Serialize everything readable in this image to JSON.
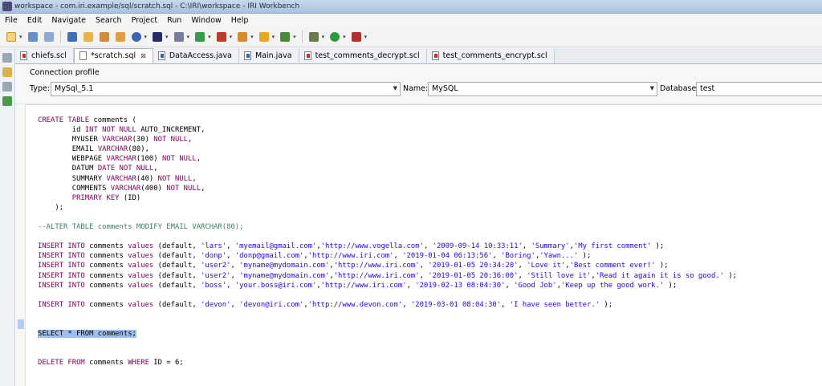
{
  "window": {
    "title": "workspace - com.iri.example/sql/scratch.sql - C:\\IRI\\workspace - IRI Workbench"
  },
  "menu": [
    "File",
    "Edit",
    "Navigate",
    "Search",
    "Project",
    "Run",
    "Window",
    "Help"
  ],
  "tabs": [
    {
      "label": "chiefs.scl",
      "icon": "sql-file-icon",
      "active": false
    },
    {
      "label": "*scratch.sql",
      "icon": "sql-file-icon",
      "active": true,
      "close": "⊠"
    },
    {
      "label": "DataAccess.java",
      "icon": "java-file-icon",
      "active": false
    },
    {
      "label": "Main.java",
      "icon": "java-file-icon",
      "active": false
    },
    {
      "label": "test_comments_decrypt.scl",
      "icon": "sql-file-icon",
      "active": false
    },
    {
      "label": "test_comments_encrypt.scl",
      "icon": "sql-file-icon",
      "active": false
    }
  ],
  "connection": {
    "section_label": "Connection profile",
    "type_label": "Type:",
    "type_value": "MySql_5.1",
    "name_label": "Name:",
    "name_value": "MySQL",
    "database_label": "Database:",
    "database_value": "test"
  },
  "code_lines": [
    [
      [
        "kw",
        "CREATE TABLE"
      ],
      [
        "",
        " comments ("
      ]
    ],
    [
      [
        "",
        "        id "
      ],
      [
        "kw",
        "INT NOT NULL"
      ],
      [
        "",
        " AUTO_INCREMENT,"
      ]
    ],
    [
      [
        "",
        "        MYUSER "
      ],
      [
        "kw",
        "VARCHAR"
      ],
      [
        "",
        "(30) "
      ],
      [
        "kw",
        "NOT NULL"
      ],
      [
        "",
        ","
      ]
    ],
    [
      [
        "",
        "        EMAIL "
      ],
      [
        "kw",
        "VARCHAR"
      ],
      [
        "",
        "(80),"
      ]
    ],
    [
      [
        "",
        "        WEBPAGE "
      ],
      [
        "kw",
        "VARCHAR"
      ],
      [
        "",
        "(100) "
      ],
      [
        "kw",
        "NOT NULL"
      ],
      [
        "",
        ","
      ]
    ],
    [
      [
        "",
        "        DATUM "
      ],
      [
        "kw",
        "DATE NOT NULL"
      ],
      [
        "",
        ","
      ]
    ],
    [
      [
        "",
        "        SUMMARY "
      ],
      [
        "kw",
        "VARCHAR"
      ],
      [
        "",
        "(40) "
      ],
      [
        "kw",
        "NOT NULL"
      ],
      [
        "",
        ","
      ]
    ],
    [
      [
        "",
        "        COMMENTS "
      ],
      [
        "kw",
        "VARCHAR"
      ],
      [
        "",
        "(400) "
      ],
      [
        "kw",
        "NOT NULL"
      ],
      [
        "",
        ","
      ]
    ],
    [
      [
        "",
        "        "
      ],
      [
        "kw",
        "PRIMARY KEY"
      ],
      [
        "",
        " (ID)"
      ]
    ],
    [
      [
        "",
        "    );"
      ]
    ],
    [
      [
        "",
        ""
      ]
    ],
    [
      [
        "cm",
        "--ALTER TABLE comments MODIFY EMAIL VARCHAR(80);"
      ]
    ],
    [
      [
        "",
        ""
      ]
    ],
    [
      [
        "kw",
        "INSERT INTO"
      ],
      [
        "",
        " comments "
      ],
      [
        "kw",
        "values"
      ],
      [
        "",
        " (default, "
      ],
      [
        "str",
        "'lars'"
      ],
      [
        "",
        ", "
      ],
      [
        "str",
        "'myemail@gmail.com'"
      ],
      [
        "",
        ","
      ],
      [
        "str",
        "'http://www.vogella.com'"
      ],
      [
        "",
        ", "
      ],
      [
        "str",
        "'2009-09-14 10:33:11'"
      ],
      [
        "",
        ", "
      ],
      [
        "str",
        "'Summary'"
      ],
      [
        "",
        ","
      ],
      [
        "str",
        "'My first comment'"
      ],
      [
        "",
        " );"
      ]
    ],
    [
      [
        "kw",
        "INSERT INTO"
      ],
      [
        "",
        " comments "
      ],
      [
        "kw",
        "values"
      ],
      [
        "",
        " (default, "
      ],
      [
        "str",
        "'donp'"
      ],
      [
        "",
        ", "
      ],
      [
        "str",
        "'donp@gmail.com'"
      ],
      [
        "",
        ","
      ],
      [
        "str",
        "'http://www.iri.com'"
      ],
      [
        "",
        ", "
      ],
      [
        "str",
        "'2019-01-04 06:13:56'"
      ],
      [
        "",
        ", "
      ],
      [
        "str",
        "'Boring'"
      ],
      [
        "",
        ","
      ],
      [
        "str",
        "'Yawn...'"
      ],
      [
        "",
        " );"
      ]
    ],
    [
      [
        "kw",
        "INSERT INTO"
      ],
      [
        "",
        " comments "
      ],
      [
        "kw",
        "values"
      ],
      [
        "",
        " (default, "
      ],
      [
        "str",
        "'user2'"
      ],
      [
        "",
        ", "
      ],
      [
        "str",
        "'myname@mydomain.com'"
      ],
      [
        "",
        ","
      ],
      [
        "str",
        "'http://www.iri.com'"
      ],
      [
        "",
        ", "
      ],
      [
        "str",
        "'2019-01-05 20:34:20'"
      ],
      [
        "",
        ", "
      ],
      [
        "str",
        "'Love it'"
      ],
      [
        "",
        ","
      ],
      [
        "str",
        "'Best comment ever!'"
      ],
      [
        "",
        " );"
      ]
    ],
    [
      [
        "kw",
        "INSERT INTO"
      ],
      [
        "",
        " comments "
      ],
      [
        "kw",
        "values"
      ],
      [
        "",
        " (default, "
      ],
      [
        "str",
        "'user2'"
      ],
      [
        "",
        ", "
      ],
      [
        "str",
        "'myname@mydomain.com'"
      ],
      [
        "",
        ","
      ],
      [
        "str",
        "'http://www.iri.com'"
      ],
      [
        "",
        ", "
      ],
      [
        "str",
        "'2019-01-05 20:36:00'"
      ],
      [
        "",
        ", "
      ],
      [
        "str",
        "'Still love it'"
      ],
      [
        "",
        ","
      ],
      [
        "str",
        "'Read it again it is so good.'"
      ],
      [
        "",
        " );"
      ]
    ],
    [
      [
        "kw",
        "INSERT INTO"
      ],
      [
        "",
        " comments "
      ],
      [
        "kw",
        "values"
      ],
      [
        "",
        " (default, "
      ],
      [
        "str",
        "'boss'"
      ],
      [
        "",
        ", "
      ],
      [
        "str",
        "'your.boss@iri.com'"
      ],
      [
        "",
        ","
      ],
      [
        "str",
        "'http://www.iri.com'"
      ],
      [
        "",
        ", "
      ],
      [
        "str",
        "'2019-02-13 08:04:30'"
      ],
      [
        "",
        ", "
      ],
      [
        "str",
        "'Good Job'"
      ],
      [
        "",
        ","
      ],
      [
        "str",
        "'Keep up the good work.'"
      ],
      [
        "",
        " );"
      ]
    ],
    [
      [
        "",
        ""
      ]
    ],
    [
      [
        "kw",
        "INSERT INTO"
      ],
      [
        "",
        " comments "
      ],
      [
        "kw",
        "values"
      ],
      [
        "",
        " (default, "
      ],
      [
        "str",
        "'devon'"
      ],
      [
        "",
        ", "
      ],
      [
        "str",
        "'devon@iri.com'"
      ],
      [
        "",
        ","
      ],
      [
        "str",
        "'http://www.devon.com'"
      ],
      [
        "",
        ", "
      ],
      [
        "str",
        "'2019-03-01 08:04:30'"
      ],
      [
        "",
        ", "
      ],
      [
        "str",
        "'I have seen better.'"
      ],
      [
        "",
        " );"
      ]
    ],
    [
      [
        "",
        ""
      ]
    ],
    [
      [
        "",
        ""
      ]
    ],
    [
      [
        "sel",
        "SELECT * FROM comments;"
      ]
    ],
    [
      [
        "",
        ""
      ]
    ],
    [
      [
        "",
        ""
      ]
    ],
    [
      [
        "kw",
        "DELETE FROM"
      ],
      [
        "",
        " comments "
      ],
      [
        "kw",
        "WHERE"
      ],
      [
        "",
        " ID = 6;"
      ]
    ]
  ],
  "colors": {
    "keyword": "#7f0055",
    "string": "#2a00ff",
    "comment": "#3f7f5f",
    "selection": "#9dbff0"
  }
}
